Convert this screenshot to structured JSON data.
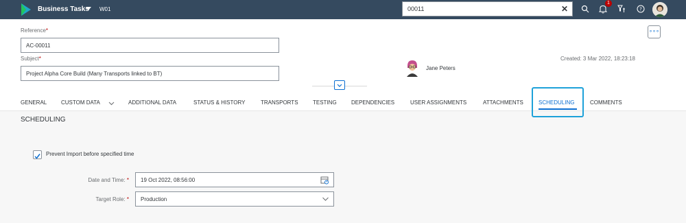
{
  "shell": {
    "app_title": "Business Tasks",
    "system_id": "W01",
    "search_value": "00011",
    "notification_count": "1",
    "icons": [
      "sap-logo-icon",
      "chevron-down-icon",
      "close-icon",
      "search-icon",
      "bell-icon",
      "filter-icon",
      "help-icon",
      "user-avatar"
    ]
  },
  "header": {
    "reference_label": "Reference",
    "reference_value": "AC-00011",
    "subject_label": "Subject",
    "subject_value": "Project Alpha Core Build (Many Transports linked to BT)",
    "required_mark": "*",
    "more_label": "∘∘∘",
    "created": "Created: 3 Mar 2022, 18:23:18",
    "person_name": "Jane Peters"
  },
  "tabs": [
    {
      "label": "GENERAL"
    },
    {
      "label": "CUSTOM DATA"
    },
    {
      "label": "ADDITIONAL DATA"
    },
    {
      "label": "STATUS & HISTORY"
    },
    {
      "label": "TRANSPORTS"
    },
    {
      "label": "TESTING"
    },
    {
      "label": "DEPENDENCIES"
    },
    {
      "label": "USER ASSIGNMENTS"
    },
    {
      "label": "ATTACHMENTS"
    },
    {
      "label": "SCHEDULING",
      "active": true
    },
    {
      "label": "COMMENTS"
    }
  ],
  "scheduling": {
    "title": "SCHEDULING",
    "prevent_import_label": "Prevent Import before specified time",
    "prevent_import_checked": true,
    "date_label": "Date and Time:",
    "date_value": "19 Oct 2022, 08:56:00",
    "role_label": "Target Role:",
    "role_value": "Production"
  },
  "colors": {
    "shell_bg": "#354a5f",
    "accent": "#0a6ed1",
    "highlight": "#1da1d9",
    "required": "#bb0000"
  }
}
